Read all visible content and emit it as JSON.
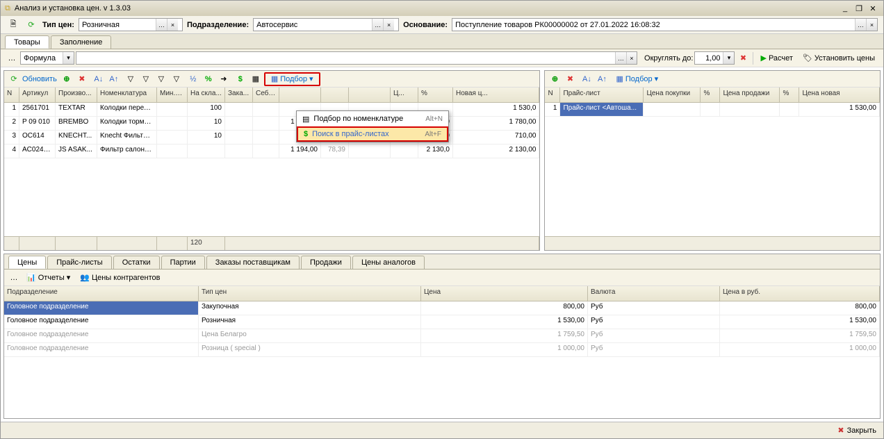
{
  "window_title": "Анализ и установка цен. v 1.3.03",
  "form": {
    "price_type_label": "Тип цен:",
    "price_type_value": "Розничная",
    "division_label": "Подразделение:",
    "division_value": "Автосервис",
    "basis_label": "Основание:",
    "basis_value": "Поступление товаров РК00000002 от 27.01.2022 16:08:32"
  },
  "main_tabs": [
    {
      "label": "Товары",
      "active": true
    },
    {
      "label": "Заполнение",
      "active": false
    }
  ],
  "subtoolbar": {
    "formula_label": "Формула",
    "round_label": "Округлять до:",
    "round_value": "1,00",
    "calc_label": "Расчет",
    "set_prices_label": "Установить цены"
  },
  "grid_toolbar": {
    "refresh": "Обновить",
    "podbor": "Подбор"
  },
  "popup": {
    "item1": {
      "label": "Подбор по номенклатуре",
      "shortcut": "Alt+N"
    },
    "item2": {
      "label": "Поиск в прайс-листах",
      "shortcut": "Alt+F"
    }
  },
  "left_headers": [
    "N",
    "Артикул",
    "Произво...",
    "Номенклатура",
    "Мин.о...",
    "На скла...",
    "Зака...",
    "Себе...",
    "",
    "",
    "",
    "Ц...",
    "%",
    "Новая ц..."
  ],
  "left_rows": [
    {
      "n": "1",
      "art": "2561701",
      "prod": "TEXTAR",
      "nom": "Колодки перед...",
      "min": "",
      "stock": "100",
      "ord": "",
      "cost": "",
      "p1": "",
      "p2": "",
      "p3": "",
      "p4": "",
      "pct": "",
      "newp": "1 530,0"
    },
    {
      "n": "2",
      "art": "P 09 010",
      "prod": "BREMBO",
      "nom": "Колодки тормо...",
      "min": "",
      "stock": "10",
      "ord": "",
      "cost": "",
      "p1": "1 000,00",
      "p2": "78,00",
      "p3": "1 000,00",
      "p4": "78,00",
      "pct": "1 780,0",
      "newp": "1 780,00"
    },
    {
      "n": "3",
      "art": "OC614",
      "prod": "KNECHT...",
      "nom": "Knecht Фильтр ...",
      "min": "",
      "stock": "10",
      "ord": "",
      "cost": "",
      "p1": "365,00",
      "p2": "94,52",
      "p3": "365,00",
      "p4": "94,52",
      "pct": "710,0",
      "newp": "710,00"
    },
    {
      "n": "4",
      "art": "AC0242...",
      "prod": "JS ASAK...",
      "nom": "Фильтр салона...",
      "min": "",
      "stock": "",
      "ord": "",
      "cost": "",
      "p1": "1 194,00",
      "p2": "78,39",
      "p3": "",
      "p4": "",
      "pct": "2 130,0",
      "newp": "2 130,00"
    }
  ],
  "left_footer_stock": "120",
  "right_toolbar": {
    "podbor": "Подбор"
  },
  "right_headers": [
    "N",
    "Прайс-лист",
    "Цена покупки",
    "%",
    "Цена продажи",
    "%",
    "Цена новая"
  ],
  "right_rows": [
    {
      "n": "1",
      "pl": "Прайс-лист <Автоша...",
      "buy": "",
      "p1": "",
      "sell": "",
      "p2": "",
      "new": "1 530,00"
    }
  ],
  "bottom_tabs": [
    {
      "label": "Цены",
      "active": true
    },
    {
      "label": "Прайс-листы"
    },
    {
      "label": "Остатки"
    },
    {
      "label": "Партии"
    },
    {
      "label": "Заказы поставщикам"
    },
    {
      "label": "Продажи"
    },
    {
      "label": "Цены аналогов"
    }
  ],
  "bottom_toolbar": {
    "reports": "Отчеты",
    "counterparty_prices": "Цены контрагентов"
  },
  "bottom_headers": [
    "Подразделение",
    "Тип цен",
    "Цена",
    "Валюта",
    "Цена в руб."
  ],
  "bottom_rows": [
    {
      "div": "Головное подразделение",
      "type": "Закупочная",
      "price": "800,00",
      "cur": "Руб",
      "rub": "800,00",
      "sel": true
    },
    {
      "div": "Головное подразделение",
      "type": "Розничная",
      "price": "1 530,00",
      "cur": "Руб",
      "rub": "1 530,00"
    },
    {
      "div": "Головное подразделение",
      "type": "Цена Белагро",
      "price": "1 759,50",
      "cur": "Руб",
      "rub": "1 759,50",
      "gray": true
    },
    {
      "div": "Головное подразделение",
      "type": "Розница ( special )",
      "price": "1 000,00",
      "cur": "Руб",
      "rub": "1 000,00",
      "gray": true
    }
  ],
  "close_label": "Закрыть"
}
